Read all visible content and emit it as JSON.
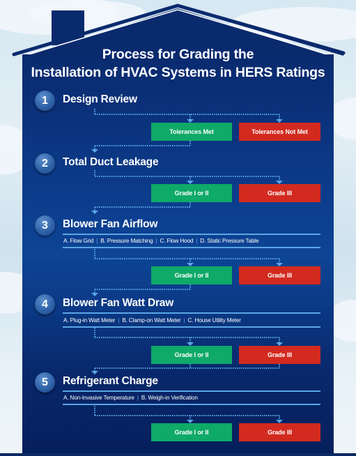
{
  "title": {
    "line1": "Process for Grading the",
    "line2": "Installation of HVAC Systems in HERS Ratings"
  },
  "colors": {
    "navy": "#0a2a6e",
    "pass": "#0fa968",
    "fail": "#d32a1f",
    "connector": "#5aa6e6"
  },
  "steps": [
    {
      "number": "1",
      "title": "Design Review",
      "methods": [],
      "outcomes": {
        "pass": "Tolerances Met",
        "fail": "Tolerances Not Met"
      }
    },
    {
      "number": "2",
      "title": "Total Duct Leakage",
      "methods": [],
      "outcomes": {
        "pass": "Grade I or II",
        "fail": "Grade III"
      }
    },
    {
      "number": "3",
      "title": "Blower Fan Airflow",
      "methods": [
        "A. Flow Grid",
        "B. Pressure Matching",
        "C. Flow Hood",
        "D. Static Pressure Table"
      ],
      "outcomes": {
        "pass": "Grade I or II",
        "fail": "Grade III"
      }
    },
    {
      "number": "4",
      "title": "Blower Fan Watt Draw",
      "methods": [
        "A. Plug-in Watt Meter",
        "B. Clamp-on Watt Meter",
        "C. House Utility Meter"
      ],
      "outcomes": {
        "pass": "Grade I or II",
        "fail": "Grade III"
      }
    },
    {
      "number": "5",
      "title": "Refrigerant Charge",
      "methods": [
        "A. Non-Invasive Temperature",
        "B. Weigh-in Verification"
      ],
      "outcomes": {
        "pass": "Grade I or II",
        "fail": "Grade III"
      }
    }
  ]
}
